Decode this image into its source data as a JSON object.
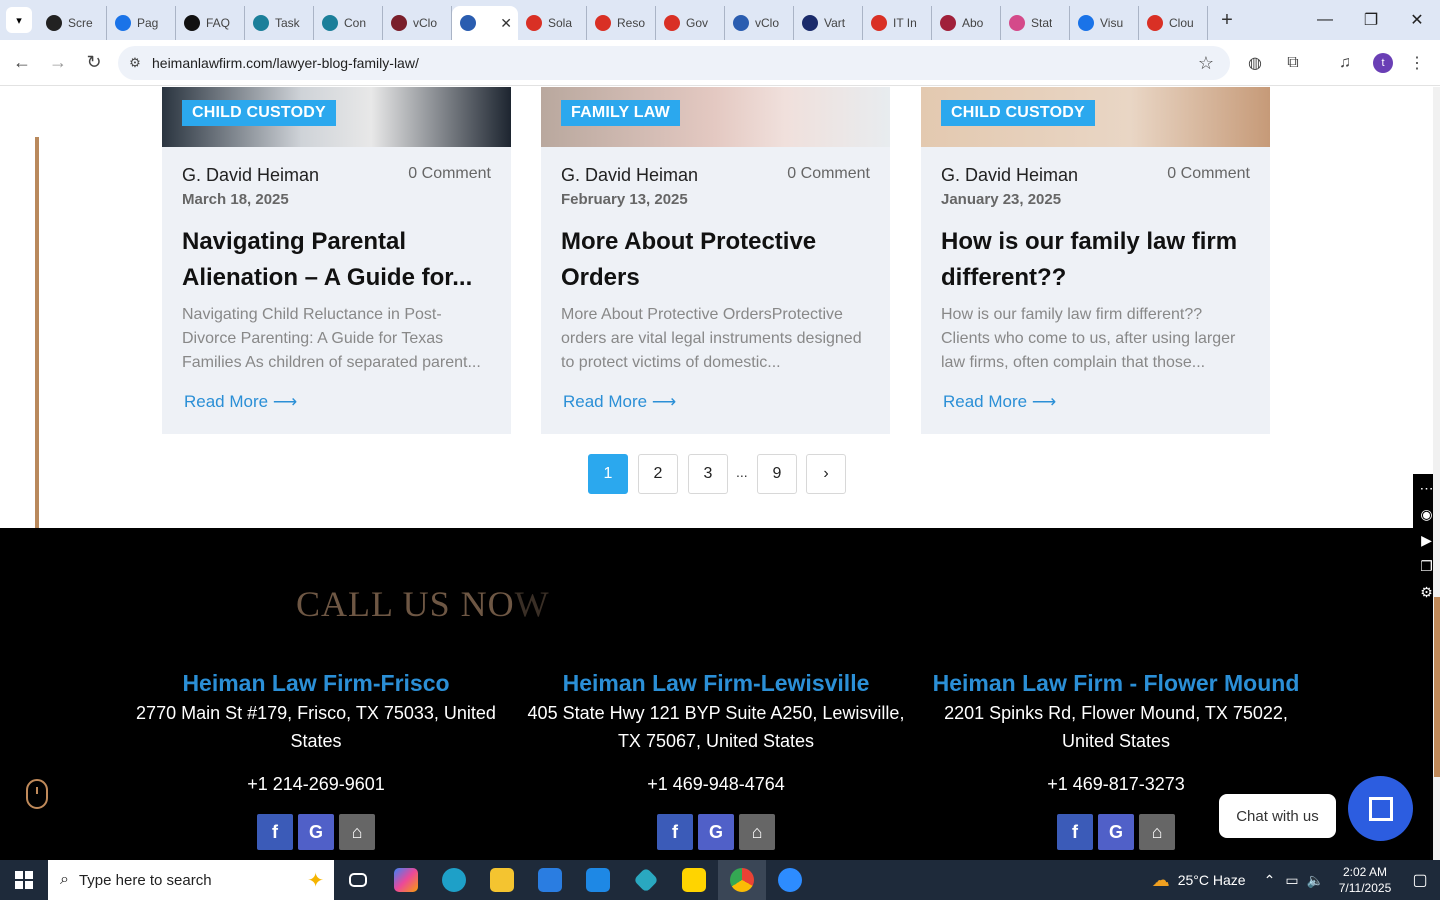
{
  "browser": {
    "tabs": [
      {
        "label": "Scre",
        "color": "#222"
      },
      {
        "label": "Pag",
        "color": "#1a73e8"
      },
      {
        "label": "FAQ",
        "color": "#111"
      },
      {
        "label": "Task",
        "color": "#1b7f9a"
      },
      {
        "label": "Con",
        "color": "#1b7f9a"
      },
      {
        "label": "vClo",
        "color": "#7a1f2b"
      },
      {
        "label": "",
        "color": "#2a5db0"
      },
      {
        "label": "Sola",
        "color": "#d93025"
      },
      {
        "label": "Reso",
        "color": "#d93025"
      },
      {
        "label": "Gov",
        "color": "#d93025"
      },
      {
        "label": "vClo",
        "color": "#2a5db0"
      },
      {
        "label": "Vart",
        "color": "#1a2b6b"
      },
      {
        "label": "IT In",
        "color": "#d93025"
      },
      {
        "label": "Abo",
        "color": "#a0203a"
      },
      {
        "label": "Stat",
        "color": "#d44a8a"
      },
      {
        "label": "Visu",
        "color": "#1a73e8"
      },
      {
        "label": "Clou",
        "color": "#d93025"
      }
    ],
    "url": "heimanlawfirm.com/lawyer-blog-family-law/",
    "profile_initial": "t"
  },
  "posts": [
    {
      "category": "CHILD CUSTODY",
      "author": "G. David Heiman",
      "comments": "0 Comment",
      "date": "March 18, 2025",
      "title": "Navigating Parental Alienation – A Guide for...",
      "excerpt": "Navigating Child Reluctance in Post-Divorce Parenting: A Guide for Texas Families As children of separated parent...",
      "read_more": "Read More ⟶"
    },
    {
      "category": "FAMILY LAW",
      "author": "G. David Heiman",
      "comments": "0 Comment",
      "date": "February 13, 2025",
      "title": "More About Protective Orders",
      "excerpt": "More About Protective OrdersProtective orders are vital legal instruments designed to protect victims of domestic...",
      "read_more": "Read More ⟶"
    },
    {
      "category": "CHILD CUSTODY",
      "author": "G. David Heiman",
      "comments": "0 Comment",
      "date": "January 23, 2025",
      "title": "How is our family law firm different??",
      "excerpt": "How is our family law firm different?? Clients who come to us, after using larger law firms, often complain that those...",
      "read_more": "Read More ⟶"
    }
  ],
  "pagination": {
    "pages": [
      "1",
      "2",
      "3"
    ],
    "ellipsis": "...",
    "last": "9",
    "next": "›",
    "current": "1"
  },
  "footer": {
    "call_us_main": "CALL US NO",
    "call_us_fade": "W",
    "offices": [
      {
        "name": "Heiman Law Firm-Frisco",
        "address": "2770 Main St #179, Frisco, TX 75033, United States",
        "phone": "+1 214-269-9601"
      },
      {
        "name": "Heiman Law Firm-Lewisville",
        "address": "405 State Hwy 121 BYP Suite A250, Lewisville, TX 75067, United States",
        "phone": "+1 469-948-4764"
      },
      {
        "name": "Heiman Law Firm - Flower Mound",
        "address": "2201 Spinks Rd, Flower Mound, TX 75022, United States",
        "phone": "+1 469-817-3273"
      }
    ],
    "social_colors": {
      "facebook": "#3b5bb8",
      "google": "#5060c8",
      "map": "#666"
    }
  },
  "chat": {
    "label": "Chat with us"
  },
  "taskbar": {
    "search_placeholder": "Type here to search",
    "weather": "25°C  Haze",
    "time": "2:02 AM",
    "date": "7/11/2025"
  },
  "colors": {
    "accent": "#2ba8ee",
    "link": "#2b8fd6",
    "bronze": "#b9895c"
  }
}
